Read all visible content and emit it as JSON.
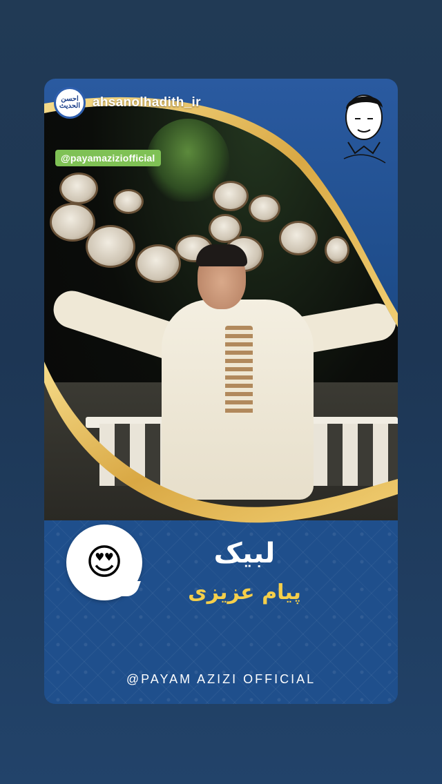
{
  "story": {
    "username": "ahsanolhadith_ir",
    "avatar_text": "احسن الحدیث",
    "mention_tag": "@payamaziziofficial",
    "portrait_icon": "portrait-sketch-icon",
    "reaction_emoji": "😍",
    "title_main": "لبیک",
    "title_sub": "پیام عزیزی",
    "footer_handle": "@PAYAM AZIZI OFFICIAL"
  },
  "colors": {
    "background": "#213a55",
    "card_blue": "#1f4f8c",
    "gold": "#e0b85a",
    "mention_green": "#7fc155",
    "subtitle_yellow": "#f5cf4a"
  }
}
